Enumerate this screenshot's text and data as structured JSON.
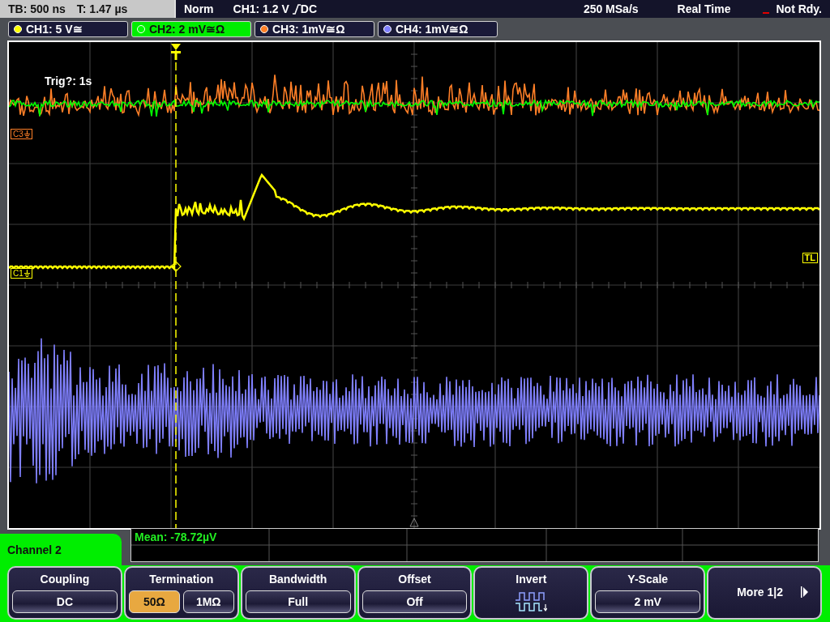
{
  "status_bar": {
    "timebase": "TB: 500 ns",
    "trigger_time": "T: 1.47 µs",
    "trigger_mode": "Norm",
    "trigger_source": "CH1: 1.2 V",
    "trigger_coupling": "DC",
    "sample_rate": "250 MSa/s",
    "acquisition": "Real Time",
    "state": "Not Rdy."
  },
  "channels": [
    {
      "label": "CH1: 5 V≅",
      "color": "#ffff00",
      "selected": false
    },
    {
      "label": "CH2: 2 mV≅Ω",
      "color": "#00ff00",
      "selected": true
    },
    {
      "label": "CH3: 1mV≅Ω",
      "color": "#ff7f27",
      "selected": false
    },
    {
      "label": "CH4: 1mV≅Ω",
      "color": "#8080ff",
      "selected": false
    }
  ],
  "plot": {
    "trigger_countdown": "Trig?: 1s",
    "markers": [
      {
        "kind": "channel",
        "label": "C3",
        "color": "#ff7f27"
      },
      {
        "kind": "channel",
        "label": "C1",
        "color": "#ffff00"
      },
      {
        "kind": "level",
        "label": "TL",
        "color": "#ffff00"
      }
    ]
  },
  "measurement": {
    "text": "Mean: -78.72µV"
  },
  "menu": {
    "title": "Channel 2",
    "softkeys": [
      {
        "kind": "options",
        "title": "Coupling",
        "options": [
          {
            "label": "DC",
            "selected": false
          }
        ]
      },
      {
        "kind": "options",
        "title": "Termination",
        "options": [
          {
            "label": "50Ω",
            "selected": true
          },
          {
            "label": "1MΩ",
            "selected": false
          }
        ]
      },
      {
        "kind": "options",
        "title": "Bandwidth",
        "options": [
          {
            "label": "Full",
            "selected": false
          }
        ]
      },
      {
        "kind": "options",
        "title": "Offset",
        "options": [
          {
            "label": "Off",
            "selected": false
          }
        ]
      },
      {
        "kind": "icon",
        "title": "Invert"
      },
      {
        "kind": "options",
        "title": "Y-Scale",
        "options": [
          {
            "label": "2 mV",
            "selected": false
          }
        ]
      },
      {
        "kind": "more",
        "title": "More 1|2"
      }
    ]
  }
}
